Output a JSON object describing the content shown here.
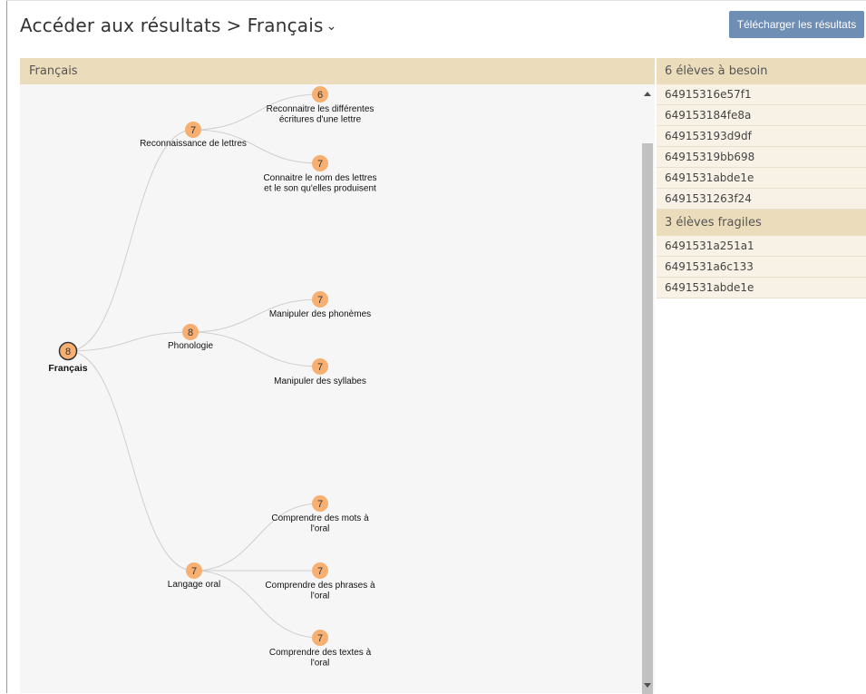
{
  "header": {
    "breadcrumb_root": "Accéder aux résultats",
    "separator": ">",
    "subject": "Français",
    "download_label": "Télécharger les résultats"
  },
  "tree": {
    "panel_title": "Français",
    "root": {
      "label": "Français",
      "value": "8"
    },
    "branches": [
      {
        "label": "Reconnaissance de lettres",
        "value": "7",
        "children": [
          {
            "label_lines": [
              "Reconnaitre les différentes",
              "écritures d'une lettre"
            ],
            "value": "6"
          },
          {
            "label_lines": [
              "Connaitre le nom des lettres",
              "et le son qu'elles produisent"
            ],
            "value": "7"
          }
        ]
      },
      {
        "label": "Phonologie",
        "value": "8",
        "children": [
          {
            "label_lines": [
              "Manipuler des phonèmes"
            ],
            "value": "7"
          },
          {
            "label_lines": [
              "Manipuler des syllabes"
            ],
            "value": "7"
          }
        ]
      },
      {
        "label": "Langage oral",
        "value": "7",
        "children": [
          {
            "label_lines": [
              "Comprendre des mots à",
              "l'oral"
            ],
            "value": "7"
          },
          {
            "label_lines": [
              "Comprendre des phrases à",
              "l'oral"
            ],
            "value": "7"
          },
          {
            "label_lines": [
              "Comprendre des textes à",
              "l'oral"
            ],
            "value": "7"
          }
        ]
      }
    ]
  },
  "sidebar": {
    "groups": [
      {
        "title": "6 élèves à besoin",
        "students": [
          "64915316e57f1",
          "649153184fe8a",
          "649153193d9df",
          "64915319bb698",
          "6491531abde1e",
          "6491531263f24"
        ]
      },
      {
        "title": "3 élèves fragiles",
        "students": [
          "6491531a251a1",
          "6491531a6c133",
          "6491531abde1e"
        ]
      }
    ]
  }
}
